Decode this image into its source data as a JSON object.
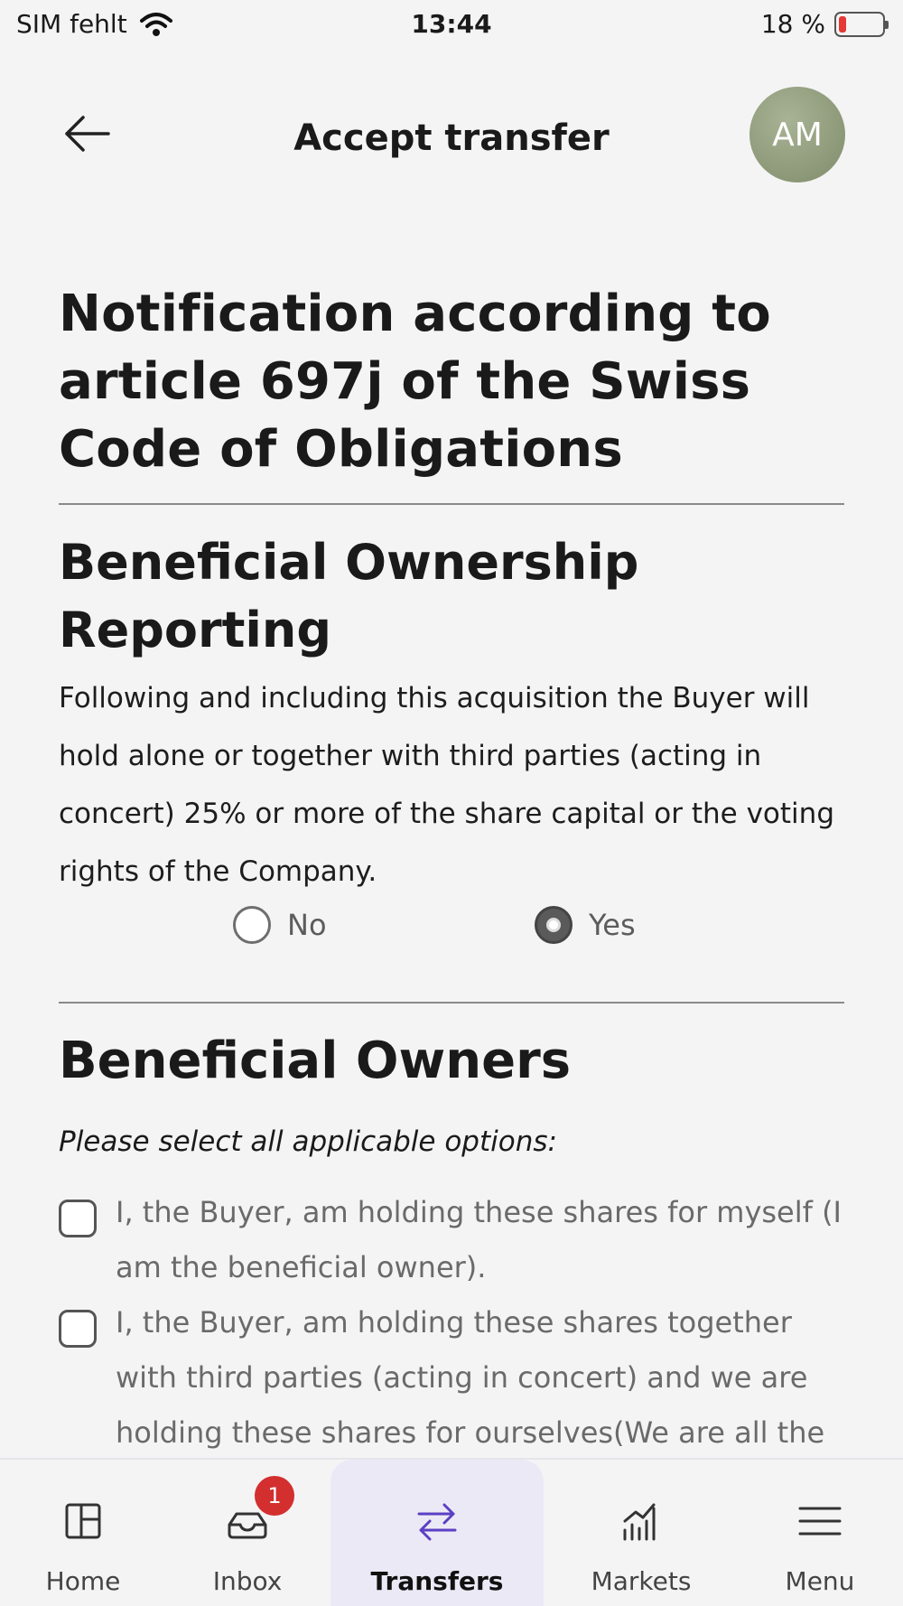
{
  "status_bar": {
    "carrier": "SIM fehlt",
    "time": "13:44",
    "battery": "18 %"
  },
  "header": {
    "title": "Accept transfer",
    "avatar_initials": "AM"
  },
  "main": {
    "title": "Notification according to article 697j of the Swiss Code of Obligations",
    "reporting": {
      "title": "Beneficial Ownership Reporting",
      "text": "Following and including this acquisition the Buyer will hold alone or together with third parties (acting in concert) 25% or more of the share capital or the voting rights of the Company.",
      "options": [
        {
          "label": "No",
          "selected": false
        },
        {
          "label": "Yes",
          "selected": true
        }
      ]
    },
    "owners": {
      "title": "Beneficial Owners",
      "instruction": "Please select all applicable options:",
      "checkboxes": [
        {
          "label": "I, the Buyer, am holding these shares for myself (I am the beneficial owner).",
          "checked": false
        },
        {
          "label": "I, the Buyer, am holding these shares together with third parties (acting in concert) and we are holding these shares for ourselves(We are all the beneficial owners).",
          "checked": false
        }
      ]
    }
  },
  "tab_bar": {
    "tabs": [
      {
        "label": "Home",
        "icon": "home-grid-icon"
      },
      {
        "label": "Inbox",
        "icon": "inbox-tray-icon",
        "badge": "1"
      },
      {
        "label": "Transfers",
        "icon": "transfer-arrows-icon",
        "active": true
      },
      {
        "label": "Markets",
        "icon": "chart-icon"
      },
      {
        "label": "Menu",
        "icon": "hamburger-menu-icon"
      }
    ]
  },
  "colors": {
    "background": "#f4f4f5",
    "accent": "#5b3fc4",
    "active_tab_bg": "#ece9f6",
    "badge": "#d32f2f",
    "avatar": "#8f9a7c"
  }
}
